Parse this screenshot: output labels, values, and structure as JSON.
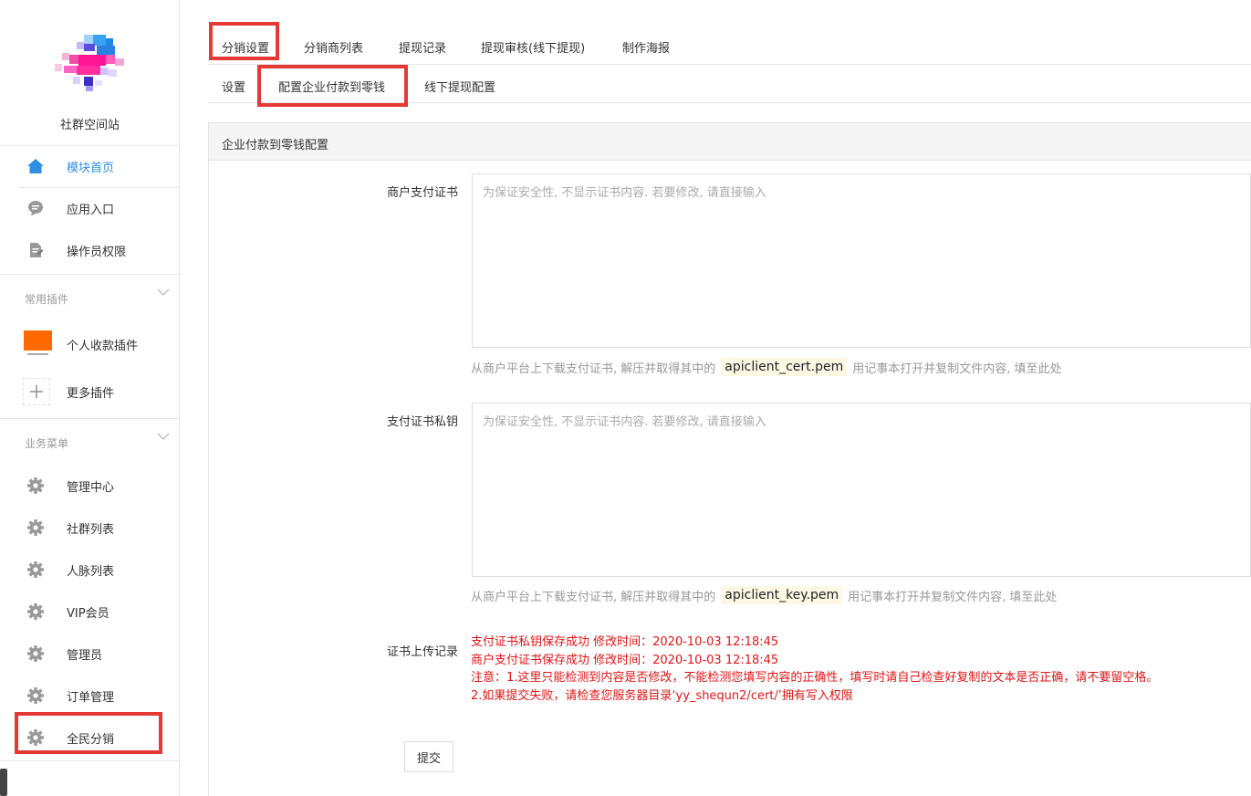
{
  "sidebar": {
    "site_name": "社群空间站",
    "items_top": [
      {
        "label": "模块首页",
        "icon": "home-icon",
        "active": true
      },
      {
        "label": "应用入口",
        "icon": "chat-bubble-icon"
      },
      {
        "label": "操作员权限",
        "icon": "document-edit-icon"
      }
    ],
    "group_plugins": {
      "title": "常用插件",
      "items": [
        {
          "label": "个人收款插件",
          "icon": "payment-plugin-icon",
          "badge_text": "个人收款"
        },
        {
          "label": "更多插件",
          "icon": "plus-icon"
        }
      ]
    },
    "group_business": {
      "title": "业务菜单",
      "items": [
        {
          "label": "管理中心",
          "icon": "gear-icon"
        },
        {
          "label": "社群列表",
          "icon": "gear-icon"
        },
        {
          "label": "人脉列表",
          "icon": "gear-icon"
        },
        {
          "label": "VIP会员",
          "icon": "gear-icon"
        },
        {
          "label": "管理员",
          "icon": "gear-icon"
        },
        {
          "label": "订单管理",
          "icon": "gear-icon"
        },
        {
          "label": "全民分销",
          "icon": "gear-icon"
        }
      ]
    }
  },
  "tabs_primary": [
    "分销设置",
    "分销商列表",
    "提现记录",
    "提现审核(线下提现)",
    "制作海报"
  ],
  "tabs_secondary": [
    "设置",
    "配置企业付款到零钱",
    "线下提现配置"
  ],
  "panel": {
    "title": "企业付款到零钱配置",
    "cert_field": {
      "label": "商户支付证书",
      "placeholder": "为保证安全性, 不显示证书内容. 若要修改, 请直接输入",
      "help_before": "从商户平台上下载支付证书, 解压并取得其中的",
      "help_code": "apiclient_cert.pem",
      "help_after": "用记事本打开并复制文件内容, 填至此处"
    },
    "key_field": {
      "label": "支付证书私钥",
      "placeholder": "为保证安全性, 不显示证书内容. 若要修改, 请直接输入",
      "help_before": "从商户平台上下载支付证书, 解压并取得其中的",
      "help_code": "apiclient_key.pem",
      "help_after": "用记事本打开并复制文件内容, 填至此处"
    },
    "log": {
      "label": "证书上传记录",
      "lines": [
        "支付证书私钥保存成功 修改时间：2020-10-03 12:18:45",
        "商户支付证书保存成功 修改时间：2020-10-03 12:18:45",
        "注意：1.这里只能检测到内容是否修改，不能检测您填写内容的正确性，填写时请自己检查好复制的文本是否正确，请不要留空格。",
        "2.如果提交失败，请检查您服务器目录‘yy_shequn2/cert/’拥有写入权限"
      ]
    },
    "submit_label": "提交"
  },
  "colors": {
    "accent": "#2f8fe0",
    "highlight": "#e53935",
    "error_text": "#e01515",
    "code_bg": "#fdf8e4"
  }
}
